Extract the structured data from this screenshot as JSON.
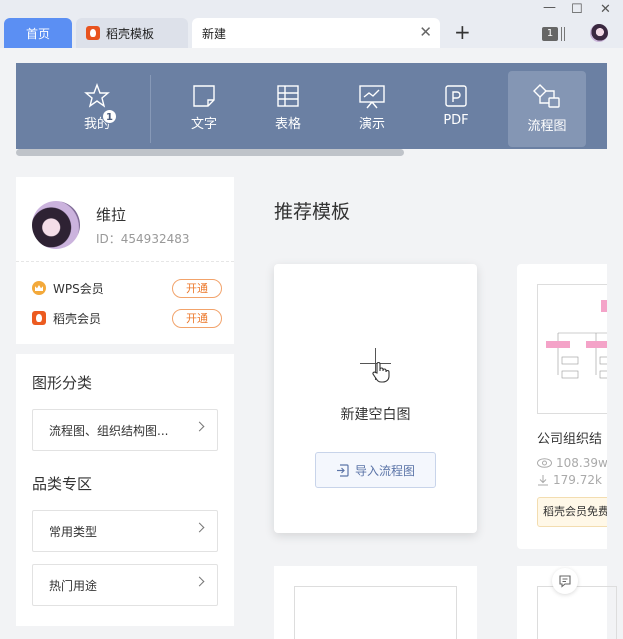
{
  "tabs": [
    {
      "label": "首页",
      "active": false
    },
    {
      "label": "稻壳模板",
      "active": false
    },
    {
      "label": "新建",
      "active": true
    }
  ],
  "window": {
    "notification_count": "1"
  },
  "categories": [
    {
      "label": "我的",
      "icon": "star-icon",
      "badge": "1"
    },
    {
      "label": "文字",
      "icon": "document-icon"
    },
    {
      "label": "表格",
      "icon": "table-icon"
    },
    {
      "label": "演示",
      "icon": "presentation-icon"
    },
    {
      "label": "PDF",
      "icon": "pdf-icon"
    },
    {
      "label": "流程图",
      "icon": "flowchart-icon",
      "active": true
    }
  ],
  "profile": {
    "name": "维拉",
    "id": "ID：454932483",
    "memberships": [
      {
        "label": "WPS会员",
        "action": "开通"
      },
      {
        "label": "稻壳会员",
        "action": "开通"
      }
    ]
  },
  "sidebar": {
    "shape_section_title": "图形分类",
    "shape_select": "流程图、组织结构图...",
    "category_section_title": "品类专区",
    "category_items": [
      "常用类型",
      "热门用途"
    ]
  },
  "main": {
    "title": "推荐模板",
    "new_blank": "新建空白图",
    "import_label": "导入流程图",
    "template": {
      "title": "公司组织结",
      "views": "108.39w",
      "downloads": "179.72k",
      "tag": "稻壳会员免费"
    }
  },
  "colors": {
    "accent": "#5b8ff3",
    "catbar": "#6b80a3",
    "member_orange": "#ec7a2e"
  }
}
